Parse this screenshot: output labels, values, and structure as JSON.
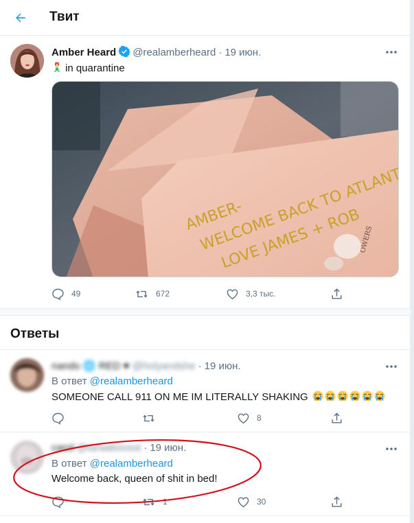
{
  "header": {
    "title": "Твит",
    "back_icon": "arrow-left-icon"
  },
  "tweet": {
    "author_name": "Amber Heard",
    "author_handle": "@realamberheard",
    "separator": "·",
    "date": "19 июн.",
    "text": "in quarantine",
    "emoji": "mermaid-emoji",
    "image_card_text": [
      "AMBER-",
      "WELCOME BACK TO ATLANTIS",
      "LOVE JAMES + ROB"
    ],
    "image_card_brand": "OWERS",
    "actions": {
      "reply": "49",
      "retweet": "672",
      "like": "3,3 тыс."
    }
  },
  "replies_title": "Ответы",
  "replies": [
    {
      "name": "nando 🌐 RED ♥",
      "handle": "@holyandshe",
      "date": "19 июн.",
      "in_reply_prefix": "В ответ",
      "in_reply_handle": "@realamberheard",
      "text": "SOMEONE CALL 911 ON ME IM LITERALLY SHAKING",
      "emoji_count": 6,
      "actions": {
        "reply": "",
        "retweet": "",
        "like": "8"
      }
    },
    {
      "name": "carol",
      "handle": "@taraaboosst",
      "date": "19 июн.",
      "in_reply_prefix": "В ответ",
      "in_reply_handle": "@realamberheard",
      "text": "Welcome back, queen of shit in bed!",
      "actions": {
        "reply": "",
        "retweet": "1",
        "like": "30"
      }
    }
  ],
  "colors": {
    "accent": "#1da1f2",
    "secondary_text": "#5b7083",
    "annotation": "#d0101a"
  }
}
